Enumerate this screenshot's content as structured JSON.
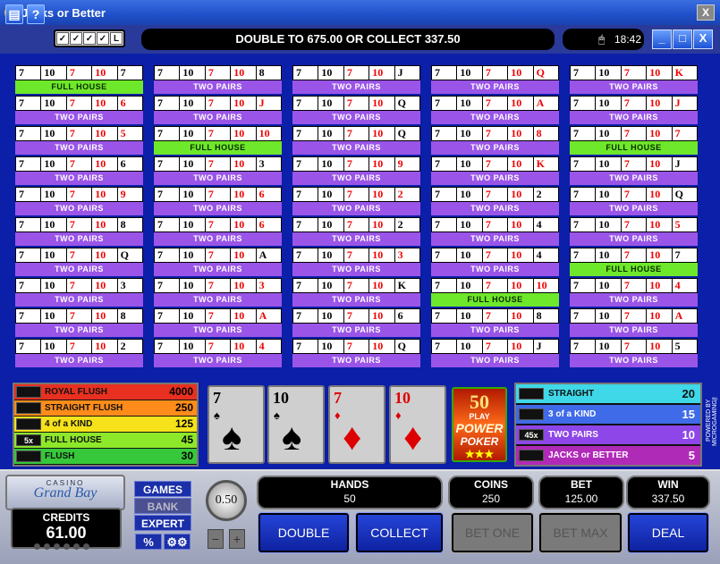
{
  "window": {
    "title": "Jacks or Better",
    "close": "X"
  },
  "toolbar": {
    "btn1": "▤",
    "btn2": "?",
    "tools": [
      "✓",
      "✓",
      "✓",
      "✓",
      "L"
    ],
    "message": "DOUBLE TO 675.00 OR COLLECT 337.50",
    "clock_icon": "🖱",
    "clock": "18:42",
    "win_min": "_",
    "win_max": "□",
    "win_close": "X"
  },
  "hands": [
    {
      "cards": [
        [
          "7",
          0
        ],
        [
          "10",
          0
        ],
        [
          "7",
          1
        ],
        [
          "10",
          1
        ],
        [
          "7",
          0
        ]
      ],
      "result": "FULL HOUSE",
      "win": true
    },
    {
      "cards": [
        [
          "7",
          0
        ],
        [
          "10",
          0
        ],
        [
          "7",
          1
        ],
        [
          "10",
          1
        ],
        [
          "6",
          1
        ]
      ],
      "result": "TWO PAIRS",
      "win": false
    },
    {
      "cards": [
        [
          "7",
          0
        ],
        [
          "10",
          0
        ],
        [
          "7",
          1
        ],
        [
          "10",
          1
        ],
        [
          "5",
          1
        ]
      ],
      "result": "TWO PAIRS",
      "win": false
    },
    {
      "cards": [
        [
          "7",
          0
        ],
        [
          "10",
          0
        ],
        [
          "7",
          1
        ],
        [
          "10",
          1
        ],
        [
          "6",
          0
        ]
      ],
      "result": "TWO PAIRS",
      "win": false
    },
    {
      "cards": [
        [
          "7",
          0
        ],
        [
          "10",
          0
        ],
        [
          "7",
          1
        ],
        [
          "10",
          1
        ],
        [
          "9",
          1
        ]
      ],
      "result": "TWO PAIRS",
      "win": false
    },
    {
      "cards": [
        [
          "7",
          0
        ],
        [
          "10",
          0
        ],
        [
          "7",
          1
        ],
        [
          "10",
          1
        ],
        [
          "8",
          0
        ]
      ],
      "result": "TWO PAIRS",
      "win": false
    },
    {
      "cards": [
        [
          "7",
          0
        ],
        [
          "10",
          0
        ],
        [
          "7",
          1
        ],
        [
          "10",
          1
        ],
        [
          "Q",
          0
        ]
      ],
      "result": "TWO PAIRS",
      "win": false
    },
    {
      "cards": [
        [
          "7",
          0
        ],
        [
          "10",
          0
        ],
        [
          "7",
          1
        ],
        [
          "10",
          1
        ],
        [
          "3",
          0
        ]
      ],
      "result": "TWO PAIRS",
      "win": false
    },
    {
      "cards": [
        [
          "7",
          0
        ],
        [
          "10",
          0
        ],
        [
          "7",
          1
        ],
        [
          "10",
          1
        ],
        [
          "8",
          0
        ]
      ],
      "result": "TWO PAIRS",
      "win": false
    },
    {
      "cards": [
        [
          "7",
          0
        ],
        [
          "10",
          0
        ],
        [
          "7",
          1
        ],
        [
          "10",
          1
        ],
        [
          "2",
          0
        ]
      ],
      "result": "TWO PAIRS",
      "win": false
    },
    {
      "cards": [
        [
          "7",
          0
        ],
        [
          "10",
          0
        ],
        [
          "7",
          1
        ],
        [
          "10",
          1
        ],
        [
          "8",
          0
        ]
      ],
      "result": "TWO PAIRS",
      "win": false
    },
    {
      "cards": [
        [
          "7",
          0
        ],
        [
          "10",
          0
        ],
        [
          "7",
          1
        ],
        [
          "10",
          1
        ],
        [
          "J",
          1
        ]
      ],
      "result": "TWO PAIRS",
      "win": false
    },
    {
      "cards": [
        [
          "7",
          0
        ],
        [
          "10",
          0
        ],
        [
          "7",
          1
        ],
        [
          "10",
          1
        ],
        [
          "10",
          1
        ]
      ],
      "result": "FULL HOUSE",
      "win": true
    },
    {
      "cards": [
        [
          "7",
          0
        ],
        [
          "10",
          0
        ],
        [
          "7",
          1
        ],
        [
          "10",
          1
        ],
        [
          "3",
          0
        ]
      ],
      "result": "TWO PAIRS",
      "win": false
    },
    {
      "cards": [
        [
          "7",
          0
        ],
        [
          "10",
          0
        ],
        [
          "7",
          1
        ],
        [
          "10",
          1
        ],
        [
          "6",
          1
        ]
      ],
      "result": "TWO PAIRS",
      "win": false
    },
    {
      "cards": [
        [
          "7",
          0
        ],
        [
          "10",
          0
        ],
        [
          "7",
          1
        ],
        [
          "10",
          1
        ],
        [
          "6",
          1
        ]
      ],
      "result": "TWO PAIRS",
      "win": false
    },
    {
      "cards": [
        [
          "7",
          0
        ],
        [
          "10",
          0
        ],
        [
          "7",
          1
        ],
        [
          "10",
          1
        ],
        [
          "A",
          0
        ]
      ],
      "result": "TWO PAIRS",
      "win": false
    },
    {
      "cards": [
        [
          "7",
          0
        ],
        [
          "10",
          0
        ],
        [
          "7",
          1
        ],
        [
          "10",
          1
        ],
        [
          "3",
          1
        ]
      ],
      "result": "TWO PAIRS",
      "win": false
    },
    {
      "cards": [
        [
          "7",
          0
        ],
        [
          "10",
          0
        ],
        [
          "7",
          1
        ],
        [
          "10",
          1
        ],
        [
          "A",
          1
        ]
      ],
      "result": "TWO PAIRS",
      "win": false
    },
    {
      "cards": [
        [
          "7",
          0
        ],
        [
          "10",
          0
        ],
        [
          "7",
          1
        ],
        [
          "10",
          1
        ],
        [
          "4",
          1
        ]
      ],
      "result": "TWO PAIRS",
      "win": false
    },
    {
      "cards": [
        [
          "7",
          0
        ],
        [
          "10",
          0
        ],
        [
          "7",
          1
        ],
        [
          "10",
          1
        ],
        [
          "J",
          0
        ]
      ],
      "result": "TWO PAIRS",
      "win": false
    },
    {
      "cards": [
        [
          "7",
          0
        ],
        [
          "10",
          0
        ],
        [
          "7",
          1
        ],
        [
          "10",
          1
        ],
        [
          "Q",
          0
        ]
      ],
      "result": "TWO PAIRS",
      "win": false
    },
    {
      "cards": [
        [
          "7",
          0
        ],
        [
          "10",
          0
        ],
        [
          "7",
          1
        ],
        [
          "10",
          1
        ],
        [
          "Q",
          0
        ]
      ],
      "result": "TWO PAIRS",
      "win": false
    },
    {
      "cards": [
        [
          "7",
          0
        ],
        [
          "10",
          0
        ],
        [
          "7",
          1
        ],
        [
          "10",
          1
        ],
        [
          "9",
          1
        ]
      ],
      "result": "TWO PAIRS",
      "win": false
    },
    {
      "cards": [
        [
          "7",
          0
        ],
        [
          "10",
          0
        ],
        [
          "7",
          1
        ],
        [
          "10",
          1
        ],
        [
          "2",
          1
        ]
      ],
      "result": "TWO PAIRS",
      "win": false
    },
    {
      "cards": [
        [
          "7",
          0
        ],
        [
          "10",
          0
        ],
        [
          "7",
          1
        ],
        [
          "10",
          1
        ],
        [
          "2",
          0
        ]
      ],
      "result": "TWO PAIRS",
      "win": false
    },
    {
      "cards": [
        [
          "7",
          0
        ],
        [
          "10",
          0
        ],
        [
          "7",
          1
        ],
        [
          "10",
          1
        ],
        [
          "3",
          1
        ]
      ],
      "result": "TWO PAIRS",
      "win": false
    },
    {
      "cards": [
        [
          "7",
          0
        ],
        [
          "10",
          0
        ],
        [
          "7",
          1
        ],
        [
          "10",
          1
        ],
        [
          "K",
          0
        ]
      ],
      "result": "TWO PAIRS",
      "win": false
    },
    {
      "cards": [
        [
          "7",
          0
        ],
        [
          "10",
          0
        ],
        [
          "7",
          1
        ],
        [
          "10",
          1
        ],
        [
          "6",
          0
        ]
      ],
      "result": "TWO PAIRS",
      "win": false
    },
    {
      "cards": [
        [
          "7",
          0
        ],
        [
          "10",
          0
        ],
        [
          "7",
          1
        ],
        [
          "10",
          1
        ],
        [
          "Q",
          0
        ]
      ],
      "result": "TWO PAIRS",
      "win": false
    },
    {
      "cards": [
        [
          "7",
          0
        ],
        [
          "10",
          0
        ],
        [
          "7",
          1
        ],
        [
          "10",
          1
        ],
        [
          "Q",
          1
        ]
      ],
      "result": "TWO PAIRS",
      "win": false
    },
    {
      "cards": [
        [
          "7",
          0
        ],
        [
          "10",
          0
        ],
        [
          "7",
          1
        ],
        [
          "10",
          1
        ],
        [
          "A",
          1
        ]
      ],
      "result": "TWO PAIRS",
      "win": false
    },
    {
      "cards": [
        [
          "7",
          0
        ],
        [
          "10",
          0
        ],
        [
          "7",
          1
        ],
        [
          "10",
          1
        ],
        [
          "8",
          1
        ]
      ],
      "result": "TWO PAIRS",
      "win": false
    },
    {
      "cards": [
        [
          "7",
          0
        ],
        [
          "10",
          0
        ],
        [
          "7",
          1
        ],
        [
          "10",
          1
        ],
        [
          "K",
          1
        ]
      ],
      "result": "TWO PAIRS",
      "win": false
    },
    {
      "cards": [
        [
          "7",
          0
        ],
        [
          "10",
          0
        ],
        [
          "7",
          1
        ],
        [
          "10",
          1
        ],
        [
          "2",
          0
        ]
      ],
      "result": "TWO PAIRS",
      "win": false
    },
    {
      "cards": [
        [
          "7",
          0
        ],
        [
          "10",
          0
        ],
        [
          "7",
          1
        ],
        [
          "10",
          1
        ],
        [
          "4",
          0
        ]
      ],
      "result": "TWO PAIRS",
      "win": false
    },
    {
      "cards": [
        [
          "7",
          0
        ],
        [
          "10",
          0
        ],
        [
          "7",
          1
        ],
        [
          "10",
          1
        ],
        [
          "4",
          0
        ]
      ],
      "result": "TWO PAIRS",
      "win": false
    },
    {
      "cards": [
        [
          "7",
          0
        ],
        [
          "10",
          0
        ],
        [
          "7",
          1
        ],
        [
          "10",
          1
        ],
        [
          "10",
          1
        ]
      ],
      "result": "FULL HOUSE",
      "win": true
    },
    {
      "cards": [
        [
          "7",
          0
        ],
        [
          "10",
          0
        ],
        [
          "7",
          1
        ],
        [
          "10",
          1
        ],
        [
          "8",
          0
        ]
      ],
      "result": "TWO PAIRS",
      "win": false
    },
    {
      "cards": [
        [
          "7",
          0
        ],
        [
          "10",
          0
        ],
        [
          "7",
          1
        ],
        [
          "10",
          1
        ],
        [
          "J",
          0
        ]
      ],
      "result": "TWO PAIRS",
      "win": false
    },
    {
      "cards": [
        [
          "7",
          0
        ],
        [
          "10",
          0
        ],
        [
          "7",
          1
        ],
        [
          "10",
          1
        ],
        [
          "K",
          1
        ]
      ],
      "result": "TWO PAIRS",
      "win": false
    },
    {
      "cards": [
        [
          "7",
          0
        ],
        [
          "10",
          0
        ],
        [
          "7",
          1
        ],
        [
          "10",
          1
        ],
        [
          "J",
          1
        ]
      ],
      "result": "TWO PAIRS",
      "win": false
    },
    {
      "cards": [
        [
          "7",
          0
        ],
        [
          "10",
          0
        ],
        [
          "7",
          1
        ],
        [
          "10",
          1
        ],
        [
          "7",
          1
        ]
      ],
      "result": "FULL HOUSE",
      "win": true
    },
    {
      "cards": [
        [
          "7",
          0
        ],
        [
          "10",
          0
        ],
        [
          "7",
          1
        ],
        [
          "10",
          1
        ],
        [
          "J",
          0
        ]
      ],
      "result": "TWO PAIRS",
      "win": false
    },
    {
      "cards": [
        [
          "7",
          0
        ],
        [
          "10",
          0
        ],
        [
          "7",
          1
        ],
        [
          "10",
          1
        ],
        [
          "Q",
          0
        ]
      ],
      "result": "TWO PAIRS",
      "win": false
    },
    {
      "cards": [
        [
          "7",
          0
        ],
        [
          "10",
          0
        ],
        [
          "7",
          1
        ],
        [
          "10",
          1
        ],
        [
          "5",
          1
        ]
      ],
      "result": "TWO PAIRS",
      "win": false
    },
    {
      "cards": [
        [
          "7",
          0
        ],
        [
          "10",
          0
        ],
        [
          "7",
          1
        ],
        [
          "10",
          1
        ],
        [
          "7",
          0
        ]
      ],
      "result": "FULL HOUSE",
      "win": true
    },
    {
      "cards": [
        [
          "7",
          0
        ],
        [
          "10",
          0
        ],
        [
          "7",
          1
        ],
        [
          "10",
          1
        ],
        [
          "4",
          1
        ]
      ],
      "result": "TWO PAIRS",
      "win": false
    },
    {
      "cards": [
        [
          "7",
          0
        ],
        [
          "10",
          0
        ],
        [
          "7",
          1
        ],
        [
          "10",
          1
        ],
        [
          "A",
          1
        ]
      ],
      "result": "TWO PAIRS",
      "win": false
    },
    {
      "cards": [
        [
          "7",
          0
        ],
        [
          "10",
          0
        ],
        [
          "7",
          1
        ],
        [
          "10",
          1
        ],
        [
          "5",
          0
        ]
      ],
      "result": "TWO PAIRS",
      "win": false
    }
  ],
  "paytable_left": [
    {
      "name": "ROYAL FLUSH",
      "value": "4000",
      "color": "#e83020",
      "mult": ""
    },
    {
      "name": "STRAIGHT FLUSH",
      "value": "250",
      "color": "#ff8c1a",
      "mult": ""
    },
    {
      "name": "4  of a KIND",
      "value": "125",
      "color": "#f5e21a",
      "mult": ""
    },
    {
      "name": "FULL HOUSE",
      "value": "45",
      "color": "#8ee82a",
      "mult": "5x"
    },
    {
      "name": "FLUSH",
      "value": "30",
      "color": "#36c83a",
      "mult": ""
    }
  ],
  "paytable_right": [
    {
      "name": "STRAIGHT",
      "value": "20",
      "color": "#3fd8e8",
      "mult": ""
    },
    {
      "name": "3 of a KIND",
      "value": "15",
      "color": "#3f6ae8",
      "mult": ""
    },
    {
      "name": "TWO PAIRS",
      "value": "10",
      "color": "#8e46e8",
      "mult": "45x"
    },
    {
      "name": "JACKS or BETTER",
      "value": "5",
      "color": "#b02ab8",
      "mult": ""
    }
  ],
  "held_cards": [
    {
      "rank": "7",
      "suit": "♠",
      "color": "#000"
    },
    {
      "rank": "10",
      "suit": "♠",
      "color": "#000"
    },
    {
      "rank": "7",
      "suit": "♦",
      "color": "#d00"
    },
    {
      "rank": "10",
      "suit": "♦",
      "color": "#d00"
    }
  ],
  "logo50": {
    "l1": "50",
    "l2": "PLAY",
    "l3": "POWER",
    "l4": "POKER",
    "l5": "★★★"
  },
  "powered_by": "POWERED BY MICROGAMING™",
  "casino": {
    "top": "CASINO",
    "name": "Grand Bay"
  },
  "credits": {
    "label": "CREDITS",
    "value": "61.00"
  },
  "side_buttons": {
    "games": "GAMES",
    "bank": "BANK",
    "expert": "EXPERT",
    "percent": "%",
    "gears": "⚙⚙"
  },
  "coin": {
    "value": "0.50",
    "minus": "−",
    "plus": "+"
  },
  "info": {
    "hands_label": "HANDS",
    "hands_value": "50",
    "coins_label": "COINS",
    "coins_value": "250",
    "bet_label": "BET",
    "bet_value": "125.00",
    "win_label": "WIN",
    "win_value": "337.50"
  },
  "actions": {
    "double": "DOUBLE",
    "collect": "COLLECT",
    "bet_one": "BET ONE",
    "bet_max": "BET MAX",
    "deal": "DEAL"
  }
}
